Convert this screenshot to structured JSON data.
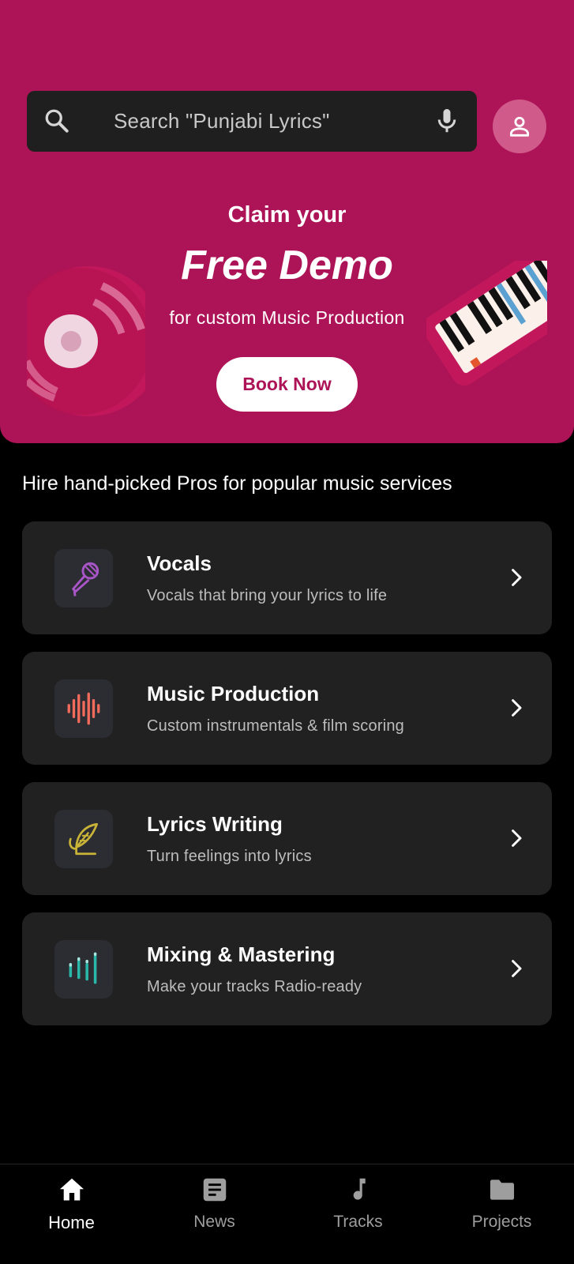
{
  "search": {
    "placeholder": "Search \"Punjabi Lyrics\"",
    "search_icon": "search-icon",
    "mic_icon": "mic-icon"
  },
  "profile": {
    "icon": "person-icon"
  },
  "hero": {
    "line1": "Claim your",
    "title": "Free Demo",
    "line3": "for custom Music Production",
    "button_label": "Book Now",
    "background_color": "#ad1457"
  },
  "section": {
    "title": "Hire hand-picked Pros for popular music services"
  },
  "services": [
    {
      "title": "Vocals",
      "subtitle": "Vocals that bring your lyrics to life",
      "icon": "microphone-icon",
      "icon_color": "#a855c7"
    },
    {
      "title": "Music Production",
      "subtitle": "Custom instrumentals & film scoring",
      "icon": "waveform-icon",
      "icon_color": "#f26b5b"
    },
    {
      "title": "Lyrics Writing",
      "subtitle": "Turn feelings into lyrics",
      "icon": "quill-icon",
      "icon_color": "#c9b437"
    },
    {
      "title": "Mixing & Mastering",
      "subtitle": "Make your tracks Radio-ready",
      "icon": "mixer-icon",
      "icon_color": "#2ab7a9"
    }
  ],
  "nav": {
    "items": [
      {
        "label": "Home",
        "icon": "home-icon",
        "active": true
      },
      {
        "label": "News",
        "icon": "news-icon",
        "active": false
      },
      {
        "label": "Tracks",
        "icon": "music-note-icon",
        "active": false
      },
      {
        "label": "Projects",
        "icon": "folder-icon",
        "active": false
      }
    ]
  }
}
